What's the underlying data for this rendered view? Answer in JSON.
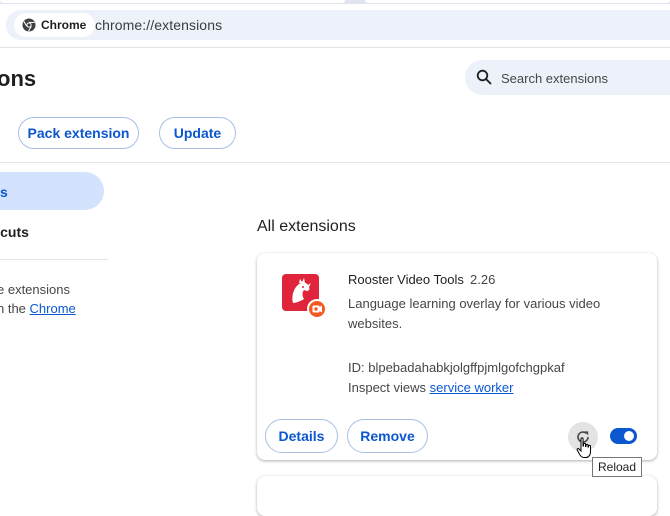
{
  "browser": {
    "chip_label": "Chrome",
    "url": "chrome://extensions"
  },
  "header": {
    "title": "ons",
    "search_placeholder": "Search extensions",
    "pack_label": "Pack extension",
    "update_label": "Update"
  },
  "sidebar": {
    "active_item": "s",
    "shortcuts_item": "rtcuts",
    "text_line1": "e extensions",
    "text_line2_prefix": "n the ",
    "text_line2_link": "Chrome"
  },
  "main": {
    "section_title": "All extensions",
    "extension": {
      "name": "Rooster Video Tools",
      "version": "2.26",
      "description": "Language learning overlay for various video websites.",
      "id_line": "ID: blpebadahabkjolgffpjmlgofchgpkaf",
      "inspect_prefix": "Inspect views ",
      "inspect_link": "service worker",
      "details_label": "Details",
      "remove_label": "Remove",
      "enabled": true,
      "icon_color": "#e0243b"
    },
    "tooltip": "Reload"
  },
  "colors": {
    "accent": "#0b57d0",
    "active_bg": "#d3e3fd",
    "omnibox_bg": "#edf1fa"
  }
}
